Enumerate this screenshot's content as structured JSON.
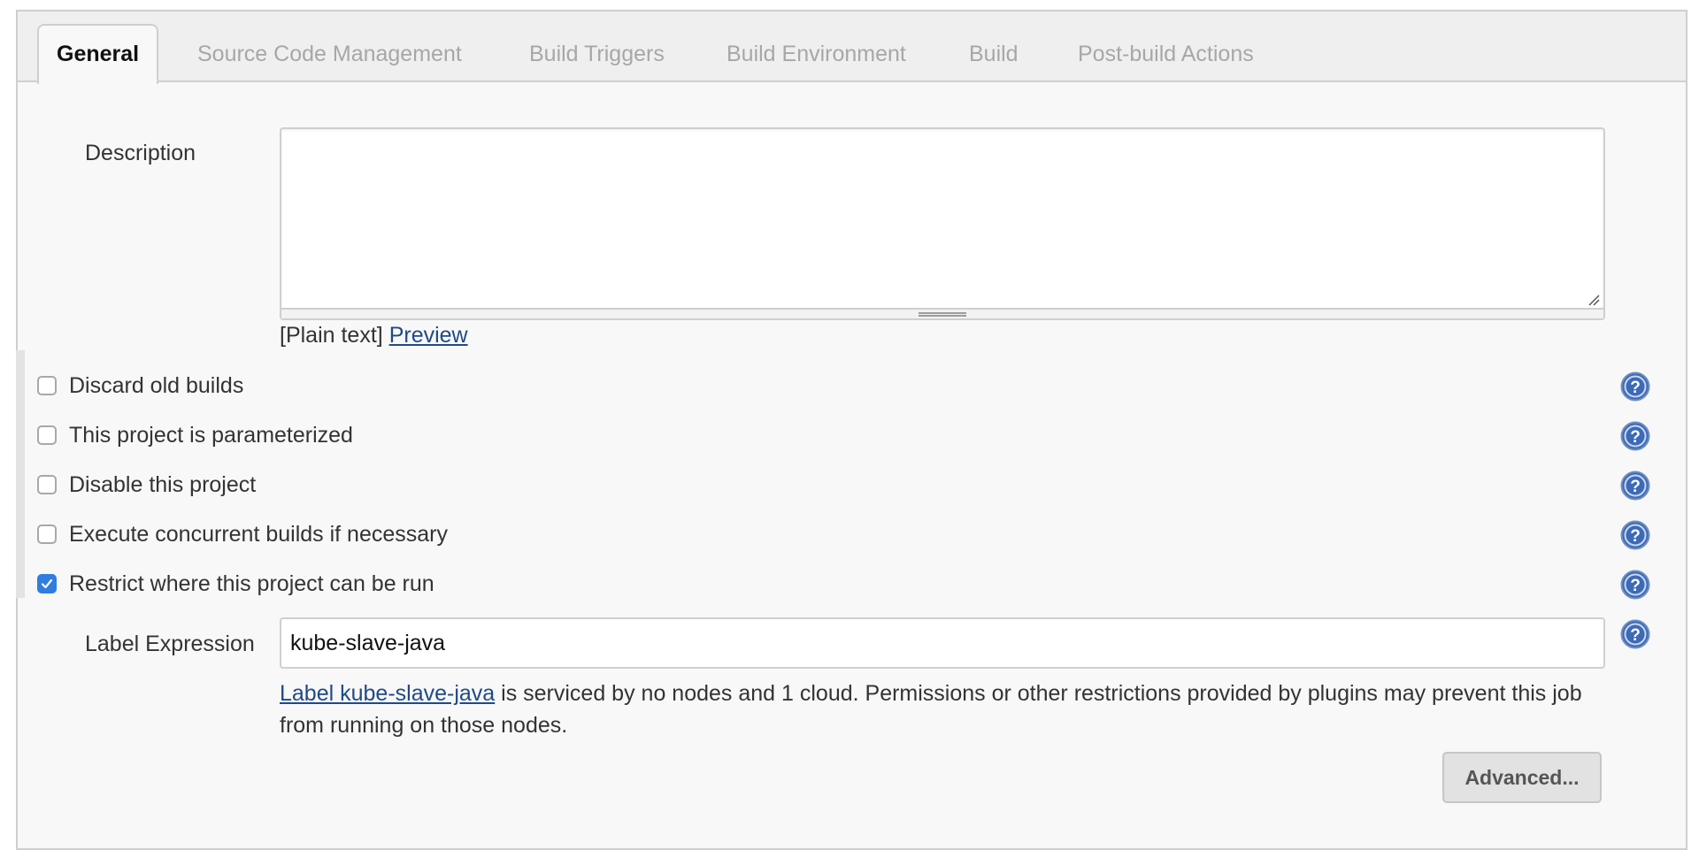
{
  "tabs": [
    {
      "label": "General",
      "active": true
    },
    {
      "label": "Source Code Management"
    },
    {
      "label": "Build Triggers"
    },
    {
      "label": "Build Environment"
    },
    {
      "label": "Build"
    },
    {
      "label": "Post-build Actions"
    }
  ],
  "description": {
    "label": "Description",
    "value": "",
    "format_text": "[Plain text]",
    "preview_link": "Preview"
  },
  "options": [
    {
      "label": "Discard old builds",
      "checked": false
    },
    {
      "label": "This project is parameterized",
      "checked": false
    },
    {
      "label": "Disable this project",
      "checked": false
    },
    {
      "label": "Execute concurrent builds if necessary",
      "checked": false
    },
    {
      "label": "Restrict where this project can be run",
      "checked": true
    }
  ],
  "label_expression": {
    "label": "Label Expression",
    "value": "kube-slave-java",
    "info_link": "Label kube-slave-java",
    "info_text": " is serviced by no nodes and 1 cloud. Permissions or other restrictions provided by plugins may prevent this job from running on those nodes."
  },
  "advanced_button": "Advanced...",
  "icons": {
    "help": "help-icon",
    "checkmark": "checkmark-icon",
    "resize": "resize-grip-icon"
  },
  "colors": {
    "link": "#204a87",
    "checkbox_checked": "#2f7de1",
    "help_icon": "#3d6ab7"
  }
}
